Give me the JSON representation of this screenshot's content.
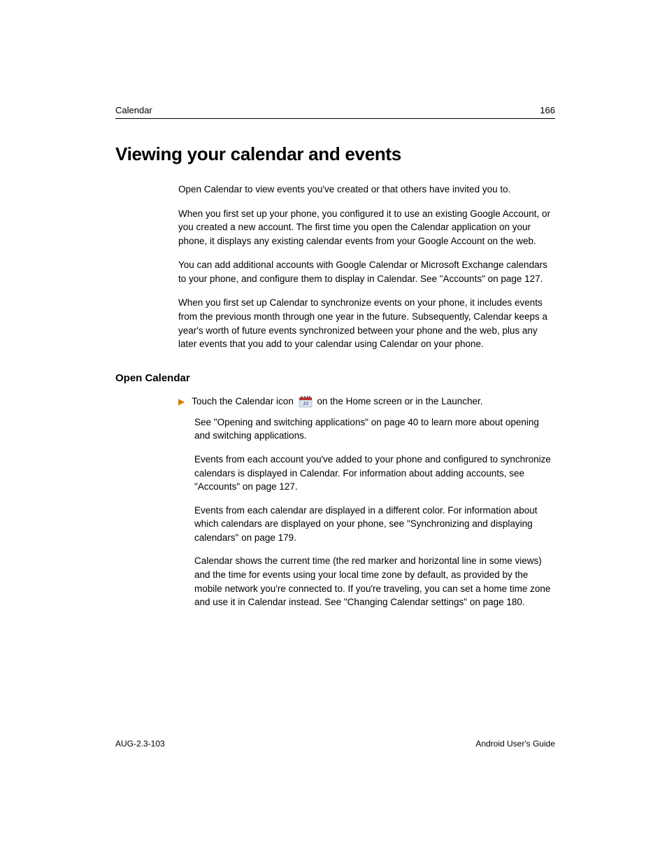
{
  "header": {
    "section_name": "Calendar",
    "page_number": "166"
  },
  "heading": "Viewing your calendar and events",
  "intro_paragraphs": [
    "Open Calendar to view events you've created or that others have invited you to.",
    "When you first set up your phone, you configured it to use an existing Google Account, or you created a new account. The first time you open the Calendar application on your phone, it displays any existing calendar events from your Google Account on the web.",
    "You can add additional accounts with Google Calendar or Microsoft Exchange calendars to your phone, and configure them to display in Calendar. See \"Accounts\" on page 127.",
    "When you first set up Calendar to synchronize events on your phone, it includes events from the previous month through one year in the future. Subsequently, Calendar keeps a year's worth of future events synchronized between your phone and the web, plus any later events that you add to your calendar using Calendar on your phone."
  ],
  "subsection": {
    "title": "Open Calendar",
    "bullet_pre": "Touch the Calendar icon ",
    "bullet_post": " on the Home screen or in the Launcher.",
    "follow_paragraphs": [
      "See \"Opening and switching applications\" on page 40 to learn more about opening and switching applications.",
      "Events from each account you've added to your phone and configured to synchronize calendars is displayed in Calendar. For information about adding accounts, see \"Accounts\" on page 127.",
      "Events from each calendar are displayed in a different color. For information about which calendars are displayed on your phone, see \"Synchronizing and displaying calendars\" on page 179.",
      "Calendar shows the current time (the red marker and horizontal line in some views) and the time for events using your local time zone by default, as provided by the mobile network you're connected to. If you're traveling, you can set a home time zone and use it in Calendar instead. See \"Changing Calendar settings\" on page 180."
    ]
  },
  "footer": {
    "left": "AUG-2.3-103",
    "right": "Android User's Guide"
  }
}
